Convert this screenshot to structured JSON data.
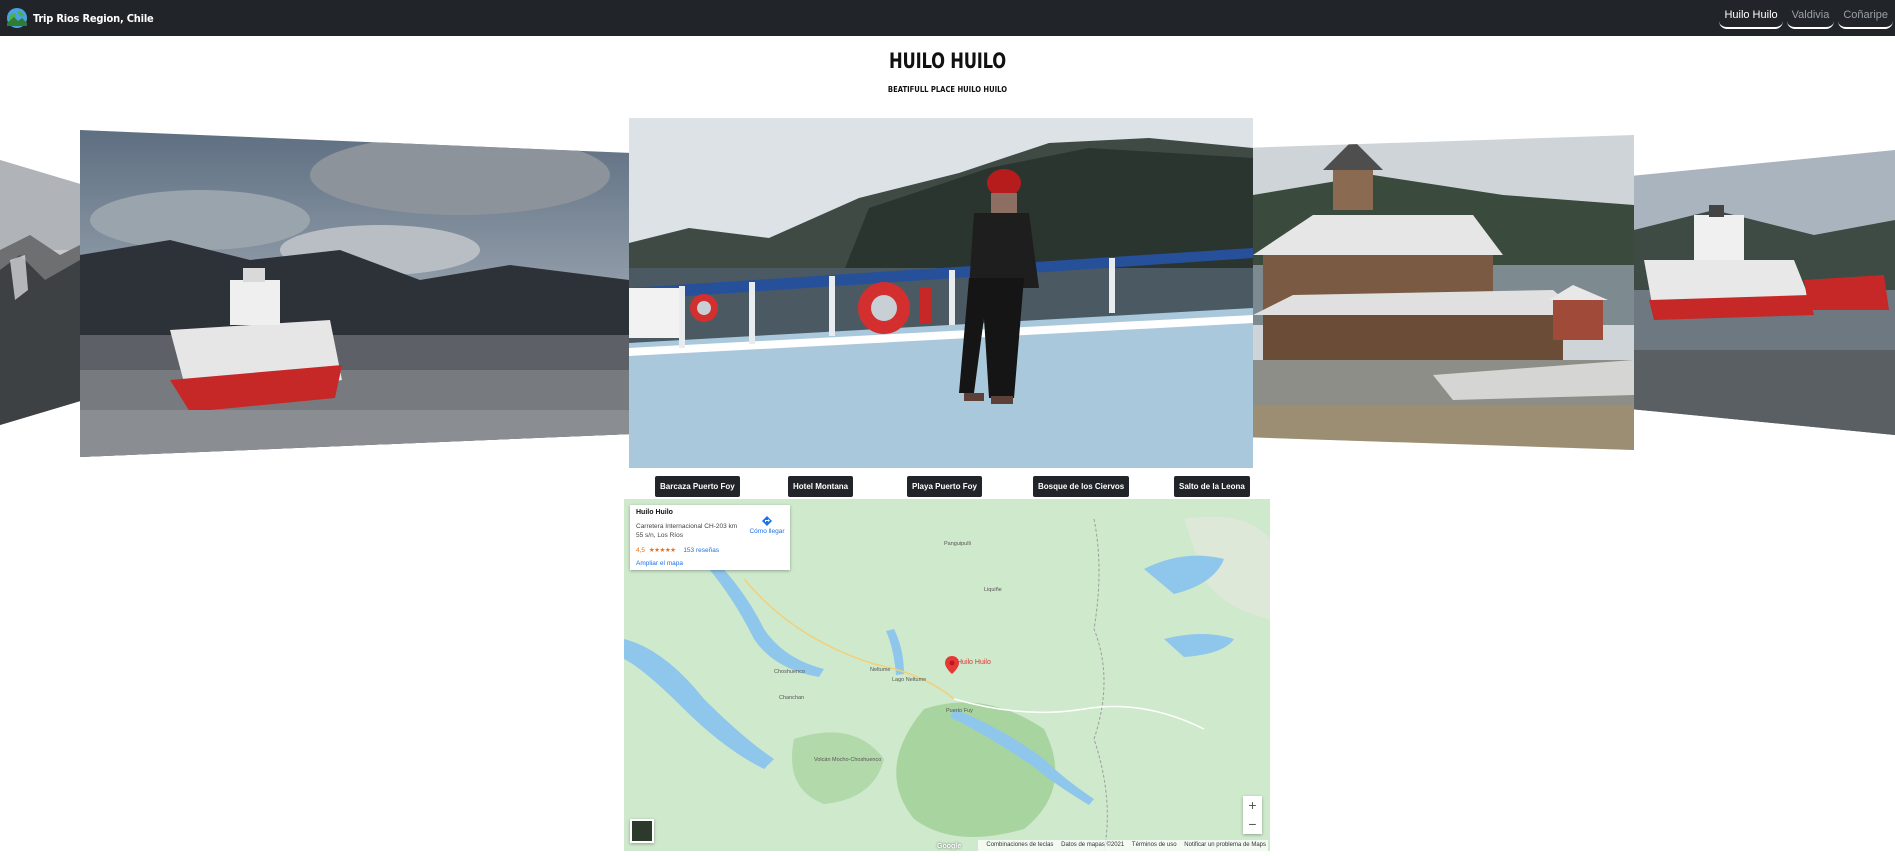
{
  "navbar": {
    "brand": "Trip Rios Region, Chile",
    "links": [
      "Huilo Huilo",
      "Valdivia",
      "Coñaripe"
    ]
  },
  "page": {
    "title": "HUILO HUILO",
    "subtitle": "BEATIFULL PLACE HUILO HUILO"
  },
  "locations": [
    "Barcaza Puerto Foy",
    "Hotel Montana",
    "Playa Puerto Foy",
    "Bosque de los Ciervos",
    "Salto de la Leona"
  ],
  "map": {
    "card": {
      "name": "Huilo Huilo",
      "address": "Carretera Internacional CH-203 km 55 s/n, Los Ríos",
      "rating": "4,5",
      "stars": "★★★★★",
      "reviews": "153 reseñas",
      "enlarge": "Ampliar el mapa",
      "directions": "Cómo llegar"
    },
    "pin_label": "Huilo Huilo",
    "labels": [
      "Neltume",
      "Puerto Fuy",
      "Choshuenco",
      "Panguipulli",
      "Liquiñe",
      "Chanchan",
      "Lago Neltume",
      "Volcán Mocho-Choshuenco"
    ],
    "zoom_in": "+",
    "zoom_out": "−",
    "google": "Google",
    "footer": [
      "Combinaciones de teclas",
      "Datos de mapas ©2021",
      "Términos de uso",
      "Notificar un problema de Maps"
    ]
  },
  "colors": {
    "navbar_bg": "#212529",
    "button_bg": "#212529",
    "map_land": "#cfe9cc",
    "map_water": "#8fc6eb",
    "pin": "#e53935"
  }
}
